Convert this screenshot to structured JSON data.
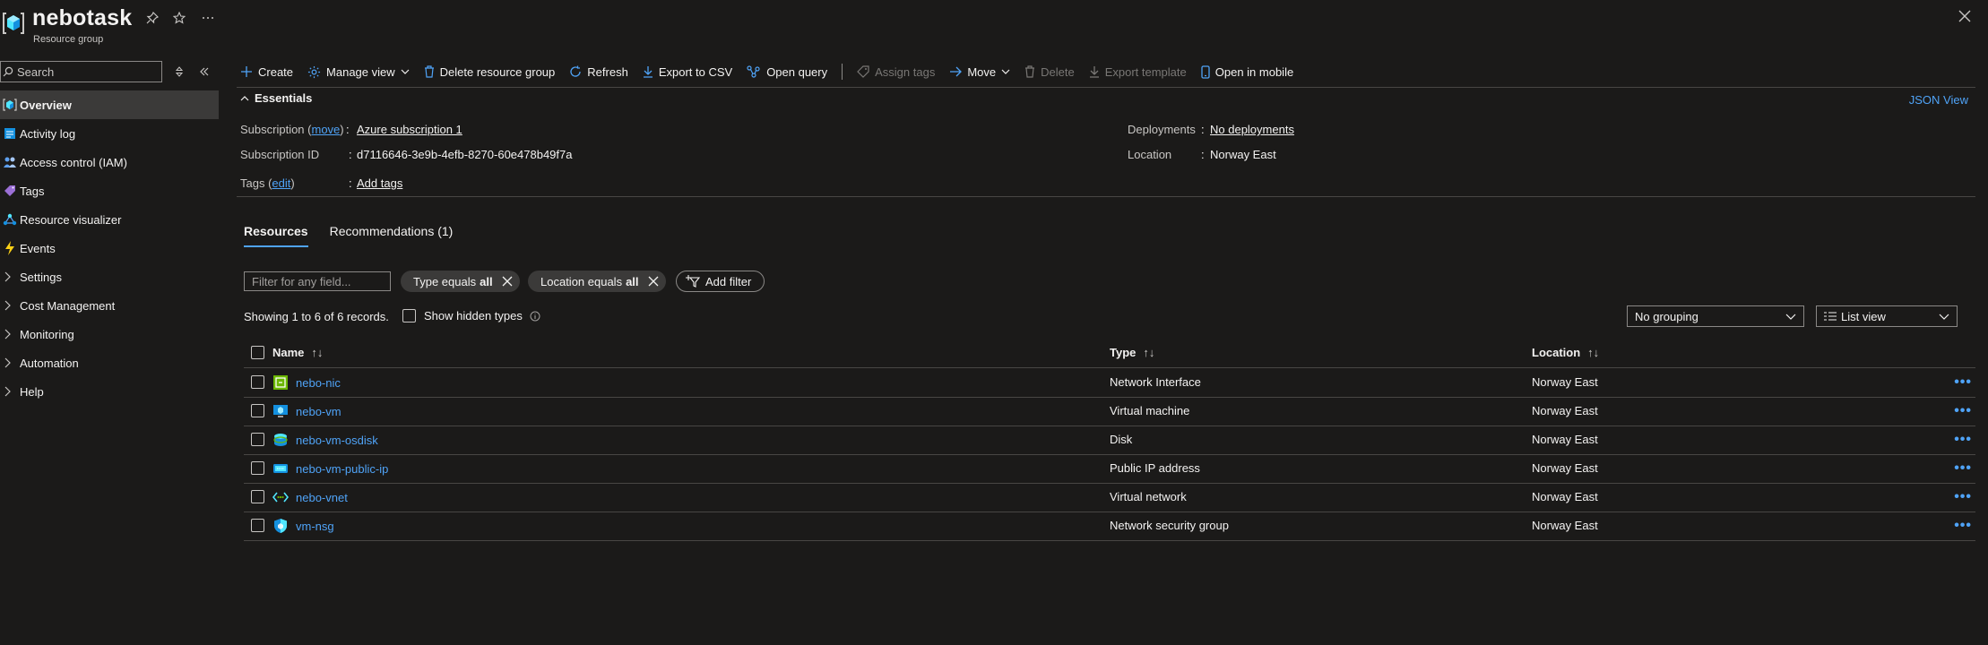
{
  "header": {
    "title": "nebotask",
    "subtitle": "Resource group"
  },
  "sidebar": {
    "search_placeholder": "Search",
    "items": [
      {
        "label": "Overview",
        "icon": "resource-group-icon",
        "active": true
      },
      {
        "label": "Activity log",
        "icon": "activity-log-icon"
      },
      {
        "label": "Access control (IAM)",
        "icon": "people-icon"
      },
      {
        "label": "Tags",
        "icon": "tag-icon"
      },
      {
        "label": "Resource visualizer",
        "icon": "visualizer-icon"
      },
      {
        "label": "Events",
        "icon": "lightning-icon"
      },
      {
        "label": "Settings",
        "expandable": true
      },
      {
        "label": "Cost Management",
        "expandable": true
      },
      {
        "label": "Monitoring",
        "expandable": true
      },
      {
        "label": "Automation",
        "expandable": true
      },
      {
        "label": "Help",
        "expandable": true
      }
    ]
  },
  "toolbar": {
    "create": "Create",
    "manage_view": "Manage view",
    "delete_rg": "Delete resource group",
    "refresh": "Refresh",
    "export_csv": "Export to CSV",
    "open_query": "Open query",
    "assign_tags": "Assign tags",
    "move": "Move",
    "delete": "Delete",
    "export_template": "Export template",
    "open_mobile": "Open in mobile"
  },
  "essentials": {
    "title": "Essentials",
    "json_view": "JSON View",
    "subscription_label": "Subscription (",
    "subscription_move": "move",
    "subscription_label_end": ")",
    "subscription_value": "Azure subscription 1",
    "subscription_id_label": "Subscription ID",
    "subscription_id_value": "d7116646-3e9b-4efb-8270-60e478b49f7a",
    "tags_label": "Tags (",
    "tags_edit": "edit",
    "tags_label_end": ")",
    "tags_value": "Add tags",
    "deployments_label": "Deployments",
    "deployments_value": "No deployments",
    "location_label": "Location",
    "location_value": "Norway East",
    "colon": ":"
  },
  "tabs": [
    {
      "label": "Resources",
      "active": true
    },
    {
      "label": "Recommendations (1)"
    }
  ],
  "filters": {
    "placeholder": "Filter for any field...",
    "type_filter_prefix": "Type equals",
    "type_filter_value": "all",
    "location_filter_prefix": "Location equals",
    "location_filter_value": "all",
    "add_filter": "Add filter"
  },
  "records_text": "Showing 1 to 6 of 6 records.",
  "show_hidden_types": "Show hidden types",
  "grouping": "No grouping",
  "view_mode": "List view",
  "table": {
    "columns": [
      "Name",
      "Type",
      "Location"
    ],
    "rows": [
      {
        "name": "nebo-nic",
        "type": "Network Interface",
        "location": "Norway East",
        "icon": "network-interface-icon"
      },
      {
        "name": "nebo-vm",
        "type": "Virtual machine",
        "location": "Norway East",
        "icon": "virtual-machine-icon"
      },
      {
        "name": "nebo-vm-osdisk",
        "type": "Disk",
        "location": "Norway East",
        "icon": "disk-icon"
      },
      {
        "name": "nebo-vm-public-ip",
        "type": "Public IP address",
        "location": "Norway East",
        "icon": "public-ip-icon"
      },
      {
        "name": "nebo-vnet",
        "type": "Virtual network",
        "location": "Norway East",
        "icon": "virtual-network-icon"
      },
      {
        "name": "vm-nsg",
        "type": "Network security group",
        "location": "Norway East",
        "icon": "network-security-group-icon"
      }
    ]
  },
  "colors": {
    "background": "#1b1a19",
    "link": "#4fa3f7",
    "active_nav": "#3b3a39",
    "divider": "#484644"
  }
}
